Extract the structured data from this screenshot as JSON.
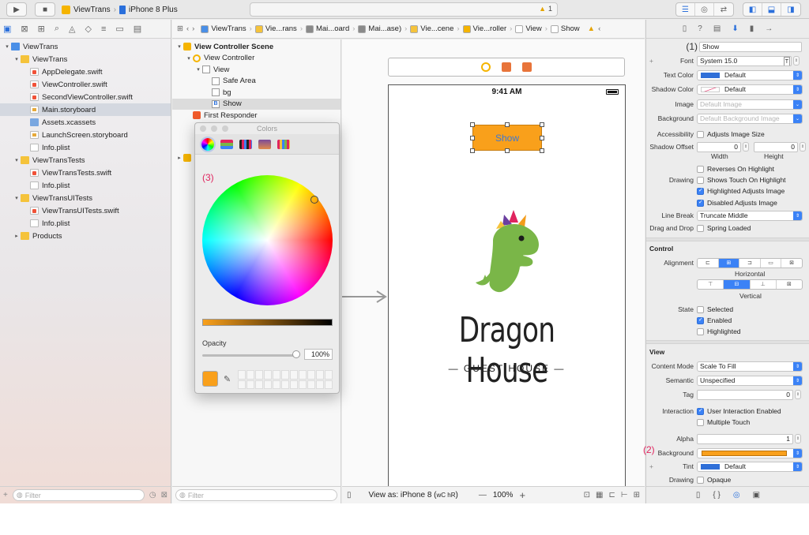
{
  "toolbar": {
    "run_icon": "play-icon",
    "stop_icon": "stop-icon",
    "scheme_name": "ViewTrans",
    "device_name": "iPhone 8 Plus",
    "warning_count": "1",
    "editor_icons": [
      "standard-editor-icon",
      "assistant-editor-icon",
      "version-editor-icon"
    ],
    "panel_icons": [
      "navigator-toggle-icon",
      "debug-toggle-icon",
      "utilities-toggle-icon"
    ]
  },
  "navigator": {
    "tab_icons": [
      "project-navigator-icon",
      "source-control-icon",
      "symbol-icon",
      "find-icon",
      "issue-icon",
      "test-icon",
      "debug-icon",
      "breakpoint-icon",
      "report-icon"
    ],
    "items": [
      {
        "label": "ViewTrans",
        "type": "proj",
        "level": 0,
        "disclosure": "▾"
      },
      {
        "label": "ViewTrans",
        "type": "folder",
        "level": 1,
        "disclosure": "▾"
      },
      {
        "label": "AppDelegate.swift",
        "type": "swift",
        "level": 2
      },
      {
        "label": "ViewController.swift",
        "type": "swift",
        "level": 2
      },
      {
        "label": "SecondViewController.swift",
        "type": "swift",
        "level": 2
      },
      {
        "label": "Main.storyboard",
        "type": "sb",
        "level": 2,
        "selected": true
      },
      {
        "label": "Assets.xcassets",
        "type": "assets",
        "level": 2
      },
      {
        "label": "LaunchScreen.storyboard",
        "type": "sb",
        "level": 2
      },
      {
        "label": "Info.plist",
        "type": "doc",
        "level": 2
      },
      {
        "label": "ViewTransTests",
        "type": "folder",
        "level": 1,
        "disclosure": "▾"
      },
      {
        "label": "ViewTransTests.swift",
        "type": "swift",
        "level": 2
      },
      {
        "label": "Info.plist",
        "type": "doc",
        "level": 2
      },
      {
        "label": "ViewTransUITests",
        "type": "folder",
        "level": 1,
        "disclosure": "▾"
      },
      {
        "label": "ViewTransUITests.swift",
        "type": "swift",
        "level": 2
      },
      {
        "label": "Info.plist",
        "type": "doc",
        "level": 2
      },
      {
        "label": "Products",
        "type": "folder",
        "level": 1,
        "disclosure": "▸"
      }
    ],
    "filter_placeholder": "Filter"
  },
  "jumpbar": {
    "items": [
      "ViewTrans",
      "Vie...rans",
      "Mai...oard",
      "Mai...ase)",
      "Vie...cene",
      "Vie...roller",
      "View",
      "Show"
    ]
  },
  "outline": {
    "items": [
      {
        "label": "View Controller Scene",
        "type": "scene",
        "level": 0,
        "disclosure": "▾",
        "bold": true
      },
      {
        "label": "View Controller",
        "type": "vc",
        "level": 1,
        "disclosure": "▾"
      },
      {
        "label": "View",
        "type": "view",
        "level": 2,
        "disclosure": "▾"
      },
      {
        "label": "Safe Area",
        "type": "view",
        "level": 3
      },
      {
        "label": "bg",
        "type": "view",
        "level": 3
      },
      {
        "label": "Show",
        "type": "btn",
        "level": 3,
        "selected": true
      },
      {
        "label": "First Responder",
        "type": "fr",
        "level": 1
      }
    ],
    "filter_placeholder": "Filter"
  },
  "canvas": {
    "status_time": "9:41 AM",
    "button_label": "Show",
    "brand_title": "Dragon House",
    "brand_subtitle": "— GUEST HOUSE —",
    "view_as": "View as: iPhone 8 (",
    "size_class": "wC hR",
    "view_as_end": ")",
    "zoom": "100%",
    "zoom_out": "—",
    "zoom_in": "+"
  },
  "colors_panel": {
    "title": "Colors",
    "annotation": "(3)",
    "opacity_label": "Opacity",
    "opacity_value": "100%",
    "current_color": "#f9a01b",
    "modes": [
      "color-wheel-icon",
      "color-sliders-icon",
      "color-palettes-icon",
      "image-palettes-icon",
      "crayons-icon"
    ]
  },
  "inspector": {
    "tab_icons": [
      "file-inspector-icon",
      "help-icon",
      "identity-inspector-icon",
      "attributes-inspector-icon",
      "size-inspector-icon",
      "connections-inspector-icon"
    ],
    "annotation_1": "(1)",
    "title_value": "Show",
    "font_label": "Font",
    "font_value": "System 15.0",
    "text_color_label": "Text Color",
    "text_color_value": "Default",
    "shadow_color_label": "Shadow Color",
    "shadow_color_value": "Default",
    "image_label": "Image",
    "image_placeholder": "Default Image",
    "background_label": "Background",
    "background_placeholder": "Default Background Image",
    "accessibility_label": "Accessibility",
    "adjusts_image_size": "Adjusts Image Size",
    "shadow_offset_label": "Shadow Offset",
    "shadow_w": "0",
    "shadow_h": "0",
    "width_label": "Width",
    "height_label": "Height",
    "reverses_on_highlight": "Reverses On Highlight",
    "drawing_label": "Drawing",
    "shows_touch": "Shows Touch On Highlight",
    "highlighted_adjusts": "Highlighted Adjusts Image",
    "disabled_adjusts": "Disabled Adjusts Image",
    "line_break_label": "Line Break",
    "line_break_value": "Truncate Middle",
    "drag_drop_label": "Drag and Drop",
    "spring_loaded": "Spring Loaded",
    "control_section": "Control",
    "alignment_label": "Alignment",
    "horizontal_label": "Horizontal",
    "vertical_label": "Vertical",
    "state_label": "State",
    "selected_label": "Selected",
    "enabled_label": "Enabled",
    "highlighted_label": "Highlighted",
    "view_section": "View",
    "content_mode_label": "Content Mode",
    "content_mode_value": "Scale To Fill",
    "semantic_label": "Semantic",
    "semantic_value": "Unspecified",
    "tag_label": "Tag",
    "tag_value": "0",
    "interaction_label": "Interaction",
    "user_interaction": "User Interaction Enabled",
    "multiple_touch": "Multiple Touch",
    "alpha_label": "Alpha",
    "alpha_value": "1",
    "annotation_2": "(2)",
    "view_background_label": "Background",
    "view_background_color": "#f9a01b",
    "tint_label": "Tint",
    "tint_value": "Default",
    "drawing2_label": "Drawing",
    "opaque_label": "Opaque",
    "bottom_icons": [
      "file-icon",
      "code-snippet-icon",
      "object-library-icon",
      "media-library-icon"
    ]
  },
  "colors": {
    "accent": "#2a6fdb",
    "button_orange": "#f9a01b",
    "annotation_red": "#e0245e",
    "default_blue": "#2f6fd8"
  }
}
